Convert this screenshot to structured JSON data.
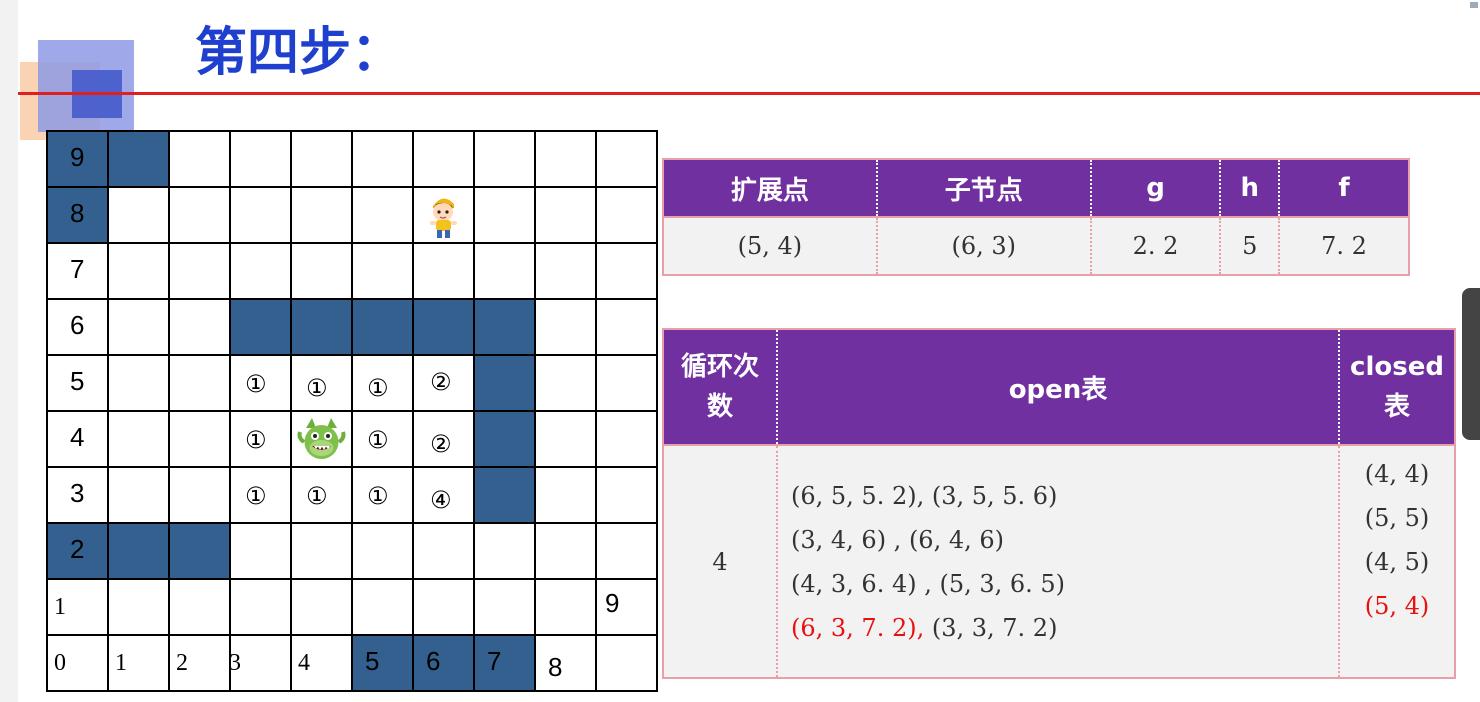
{
  "title": "第四步：",
  "grid": {
    "row_labels": [
      "9",
      "8",
      "7",
      "6",
      "5",
      "4",
      "3",
      "2"
    ],
    "row1_label": "1",
    "row1_right_label": "9",
    "col_labels": [
      "0",
      "1",
      "2",
      "3",
      "4",
      "5",
      "6",
      "7",
      "8"
    ],
    "marks": {
      "r5": [
        "①",
        "①",
        "①",
        "②"
      ],
      "r4": [
        "①",
        "①",
        "②"
      ],
      "r3": [
        "①",
        "①",
        "①",
        "④"
      ]
    }
  },
  "table1": {
    "headers": [
      "扩展点",
      "子节点",
      "g",
      "h",
      "f"
    ],
    "row": [
      "(5, 4)",
      "(6, 3)",
      "2. 2",
      "5",
      "7. 2"
    ]
  },
  "table2": {
    "headers": [
      "循环次数",
      "open表",
      "closed表"
    ],
    "loop": "4",
    "open_lines": [
      "(6, 5, 5. 2), (3, 5, 5. 6)",
      " (3, 4, 6) , (6, 4, 6)",
      " (4, 3,  6. 4) ,   (5, 3, 6. 5)"
    ],
    "open_last_red": "(6, 3, 7. 2),",
    "open_last_rest": " (3, 3, 7. 2)",
    "closed": [
      "(4, 4)",
      "(5, 5)",
      "(4, 5)"
    ],
    "closed_red": "(5, 4)"
  },
  "colors": {
    "title": "#1f3fcf",
    "wall": "#34608f",
    "header": "#7030a0",
    "highlight": "#e81010"
  },
  "icons": [
    "boy-icon",
    "monster-icon"
  ]
}
